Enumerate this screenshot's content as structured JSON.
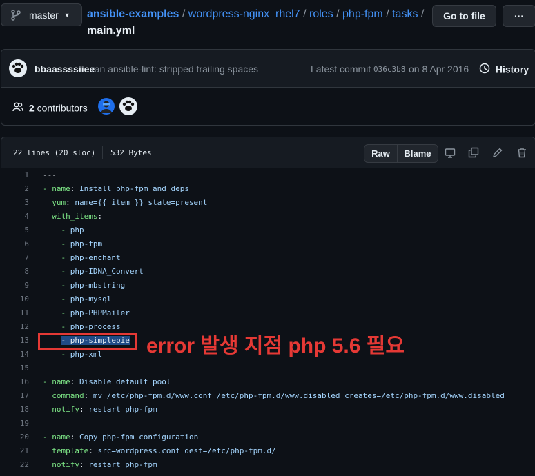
{
  "branch": {
    "name": "master"
  },
  "breadcrumb": {
    "repo": "ansible-examples",
    "parts": [
      "wordpress-nginx_rhel7",
      "roles",
      "php-fpm",
      "tasks"
    ],
    "file": "main.yml",
    "separator": "/"
  },
  "actions": {
    "go_to_file": "Go to file",
    "more": "···"
  },
  "commit": {
    "author": "bbaassssiiee",
    "message": "ran ansible-lint: stripped trailing spaces",
    "latest_label": "Latest commit",
    "sha": "036c3b8",
    "date": "on 8 Apr 2016",
    "history": "History"
  },
  "contributors": {
    "count": "2",
    "label": "contributors"
  },
  "file_info": {
    "lines": "22 lines (20 sloc)",
    "size": "532 Bytes"
  },
  "file_actions": {
    "raw": "Raw",
    "blame": "Blame"
  },
  "code": {
    "lines": [
      {
        "n": "1",
        "indent": "",
        "dash": "",
        "key": "",
        "val": "---"
      },
      {
        "n": "2",
        "indent": "",
        "dash": "- ",
        "key": "name",
        "val": "Install php-fpm and deps"
      },
      {
        "n": "3",
        "indent": "  ",
        "dash": "",
        "key": "yum",
        "val": "name={{ item }} state=present"
      },
      {
        "n": "4",
        "indent": "  ",
        "dash": "",
        "key": "with_items",
        "val": ""
      },
      {
        "n": "5",
        "indent": "    ",
        "dash": "- ",
        "key": "",
        "val": "php"
      },
      {
        "n": "6",
        "indent": "    ",
        "dash": "- ",
        "key": "",
        "val": "php-fpm"
      },
      {
        "n": "7",
        "indent": "    ",
        "dash": "- ",
        "key": "",
        "val": "php-enchant"
      },
      {
        "n": "8",
        "indent": "    ",
        "dash": "- ",
        "key": "",
        "val": "php-IDNA_Convert"
      },
      {
        "n": "9",
        "indent": "    ",
        "dash": "- ",
        "key": "",
        "val": "php-mbstring"
      },
      {
        "n": "10",
        "indent": "    ",
        "dash": "- ",
        "key": "",
        "val": "php-mysql"
      },
      {
        "n": "11",
        "indent": "    ",
        "dash": "- ",
        "key": "",
        "val": "php-PHPMailer"
      },
      {
        "n": "12",
        "indent": "    ",
        "dash": "- ",
        "key": "",
        "val": "php-process"
      },
      {
        "n": "13",
        "indent": "    ",
        "dash": "- ",
        "key": "",
        "val": "php-simplepie"
      },
      {
        "n": "14",
        "indent": "    ",
        "dash": "- ",
        "key": "",
        "val": "php-xml"
      },
      {
        "n": "15",
        "indent": "",
        "dash": "",
        "key": "",
        "val": ""
      },
      {
        "n": "16",
        "indent": "",
        "dash": "- ",
        "key": "name",
        "val": "Disable default pool"
      },
      {
        "n": "17",
        "indent": "  ",
        "dash": "",
        "key": "command",
        "val": "mv /etc/php-fpm.d/www.conf /etc/php-fpm.d/www.disabled creates=/etc/php-fpm.d/www.disabled"
      },
      {
        "n": "18",
        "indent": "  ",
        "dash": "",
        "key": "notify",
        "val": "restart php-fpm"
      },
      {
        "n": "19",
        "indent": "",
        "dash": "",
        "key": "",
        "val": ""
      },
      {
        "n": "20",
        "indent": "",
        "dash": "- ",
        "key": "name",
        "val": "Copy php-fpm configuration"
      },
      {
        "n": "21",
        "indent": "  ",
        "dash": "",
        "key": "template",
        "val": "src=wordpress.conf dest=/etc/php-fpm.d/"
      },
      {
        "n": "22",
        "indent": "  ",
        "dash": "",
        "key": "notify",
        "val": "restart php-fpm"
      }
    ]
  },
  "annotation": {
    "text": "error 발생 지점 php 5.6 필요",
    "color": "#e53935"
  },
  "colors": {
    "link": "#4493f8",
    "key": "#7ee787",
    "string": "#a5d6ff",
    "background": "#0d1117"
  }
}
